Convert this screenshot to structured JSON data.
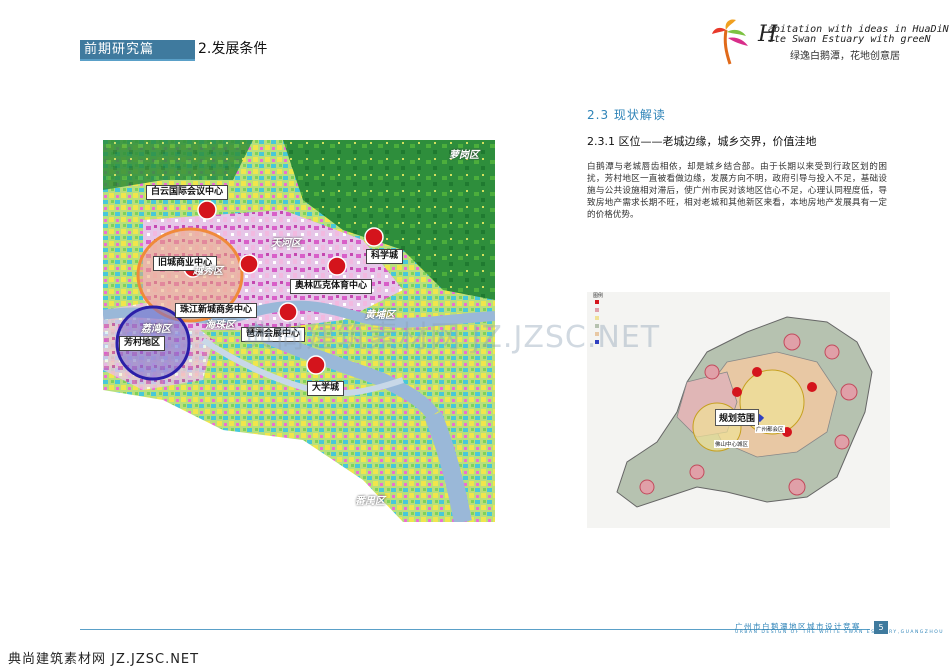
{
  "header": {
    "section_label": "前期研究篇",
    "sub_label": "2.发展条件",
    "brand_line1": "abitation with ideas in HuaDiN",
    "brand_line2": "ite Swan Estuary with greeN",
    "brand_cn": "绿逸白鹅潭，花地创意居"
  },
  "content": {
    "section_title": "2.3 现状解读",
    "subsection_title": "2.3.1 区位——老城边缘，城乡交界，价值洼地",
    "paragraph": "白鹅潭与老城唇齿相依，却是城乡结合部。由于长期以来受到行政区划的困扰，芳村地区一直被看做边缘，发展方向不明，政府引导与投入不足，基础设施与公共设施相对滞后，使广州市民对该地区信心不足，心理认同程度低，导致房地产需求长期不旺，相对老城和其他新区来看，本地房地产发展具有一定的价格优势。"
  },
  "main_map": {
    "labels": {
      "baiyun": "白云国际会议中心",
      "old_city": "旧城商业中心",
      "zhujiang": "珠江新城商务中心",
      "fangcun": "芳村地区",
      "pazhou": "琶洲会展中心",
      "olympic": "奥林匹克体育中心",
      "science": "科学城",
      "university": "大学城"
    },
    "districts": {
      "luogang": "萝岗区",
      "tianhe": "天河区",
      "yuexiu": "越秀区",
      "haizhu": "海珠区",
      "huangpu": "黄埔区",
      "panyu": "番禺区",
      "liwan": "荔湾区"
    }
  },
  "small_map": {
    "legend_title": "图例",
    "plan_label": "规划范围",
    "center_label": "广州都会区",
    "foshan_label": "佛山中心城区"
  },
  "watermark": "典尚建筑素材网 JZ.JZSC.NET",
  "footer": {
    "title": "广州市白鹅潭地区城市设计竞赛",
    "subtitle": "URBAN DESIGN OF THE WHITE SWAN ESTUARY,GUANGZHOU",
    "page": "5",
    "credit": "典尚建筑素材网 JZ.JZSC.NET"
  },
  "colors": {
    "accent": "#3f7a9e",
    "title_blue": "#2f84b8",
    "marker_red": "#d4141c"
  }
}
